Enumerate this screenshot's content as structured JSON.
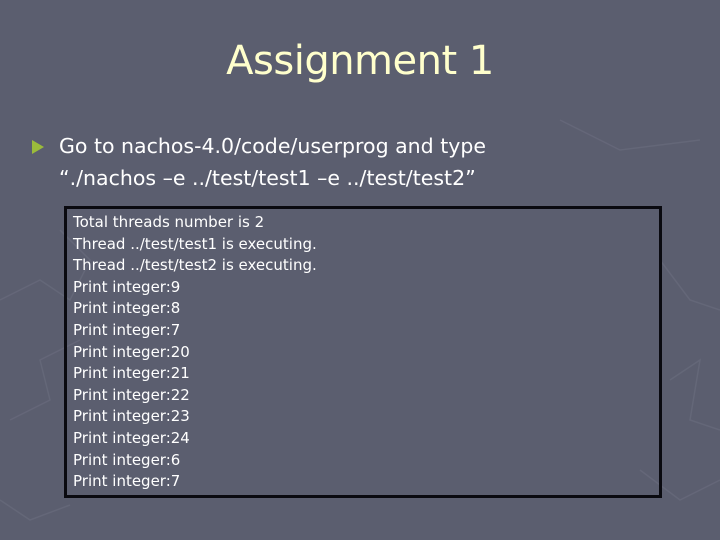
{
  "slide": {
    "title": "Assignment 1",
    "bullet": {
      "icon": "triangle-bullet-icon",
      "color": "#9bbb3b",
      "line1": "Go to nachos-4.0/code/userprog and type",
      "line2": "“./nachos –e ../test/test1 –e ../test/test2”"
    },
    "console_output": [
      "Total threads number is 2",
      "Thread ../test/test1 is executing.",
      "Thread ../test/test2 is executing.",
      "Print integer:9",
      "Print integer:8",
      "Print integer:7",
      "Print integer:20",
      "Print integer:21",
      "Print integer:22",
      "Print integer:23",
      "Print integer:24",
      "Print integer:6",
      "Print integer:7"
    ]
  },
  "colors": {
    "background": "#5b5e6f",
    "title": "#ffffcc",
    "text": "#ffffff"
  }
}
